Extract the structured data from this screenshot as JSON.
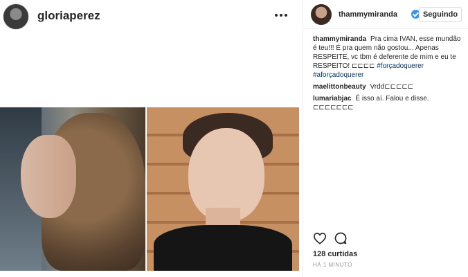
{
  "post": {
    "author_username": "gloriaperez",
    "more_icon": "more-dots-icon"
  },
  "sidebar": {
    "author_username": "thammymiranda",
    "verified_icon": "verified-badge-icon",
    "follow_label": "Seguindo",
    "caption": {
      "user": "thammymiranda",
      "text": "Pra cima IVAN, esse mundão é teu!!! É pra quem não gostou... Apenas RESPEITE, vc tbm é deferente de mim e eu te RESPEITO! ⊏⊏⊏⊏",
      "hashtags": [
        "#forçadoquerer",
        "#aforçadoquerer"
      ]
    },
    "comments": [
      {
        "user": "maelittonbeauty",
        "text": "Vrdd⊏⊏⊏⊏⊏"
      },
      {
        "user": "lumariabjac",
        "text": "É isso aí. Falou e disse. ⊏⊏⊏⊏⊏⊏⊏"
      }
    ],
    "likes_text": "128 curtidas",
    "timestamp": "HÁ 1 MINUTO",
    "like_icon": "heart-icon",
    "comment_icon": "comment-icon"
  },
  "colors": {
    "link_blue": "#003569",
    "verified_blue": "#3897f0",
    "muted_gray": "#999999"
  }
}
